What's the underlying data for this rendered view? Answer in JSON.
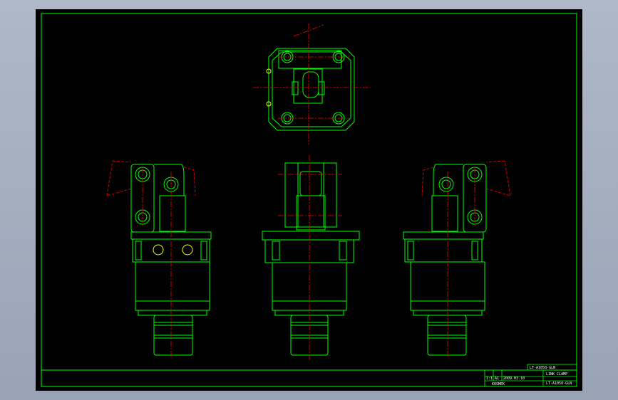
{
  "colors": {
    "background": "#000000",
    "frame": "#00ff00",
    "outline": "#00ff00",
    "centerline": "#ff0000",
    "bolt": "#ffff00",
    "text": "#ffffff"
  },
  "title_block": {
    "drawing_code": "LT-A1050-GLN",
    "name": "LINK CLAMP",
    "part_no": "LT-A1050-GLN",
    "scale": "1:1",
    "size": "A1",
    "date": "2009.03.10",
    "company": "KOSMEK"
  }
}
